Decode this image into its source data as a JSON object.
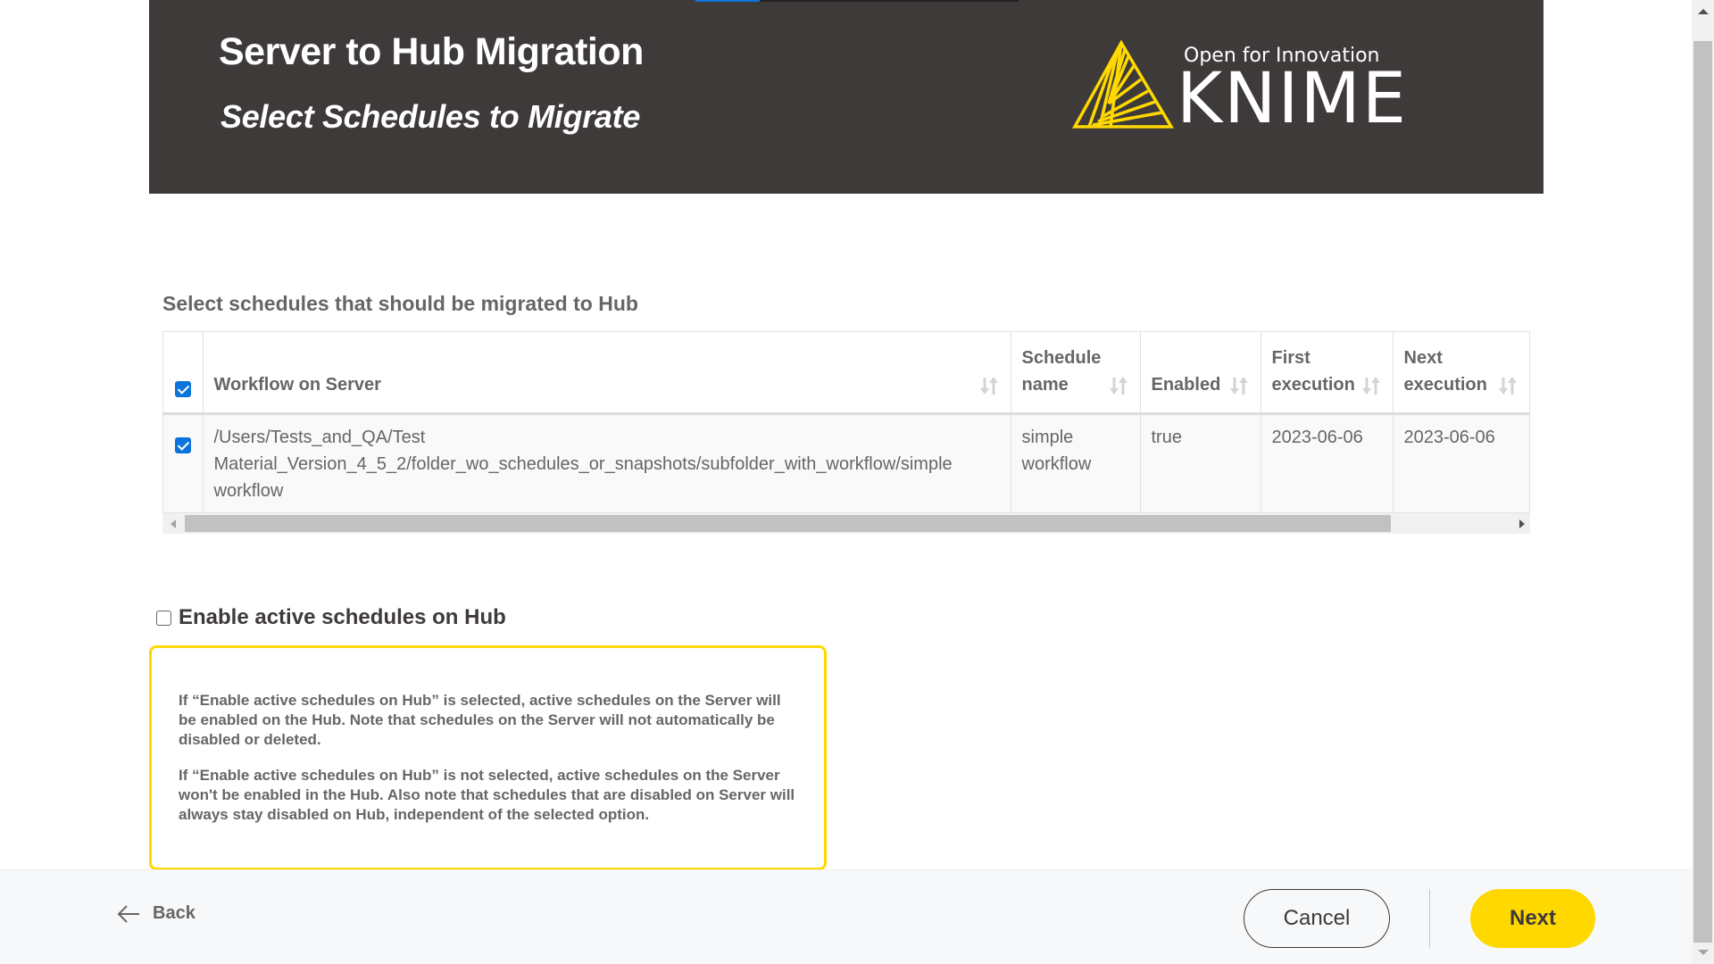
{
  "header": {
    "title": "Server to Hub Migration",
    "subtitle": "Select Schedules to Migrate",
    "progress_fraction": 0.2,
    "logo": {
      "tagline": "Open for Innovation",
      "name": "KNIME"
    }
  },
  "section_label": "Select schedules that should be migrated to Hub",
  "table": {
    "select_all_checked": true,
    "columns": [
      {
        "label": "Workflow on Server",
        "sortable": true
      },
      {
        "label": "Schedule name",
        "sortable": true
      },
      {
        "label": "Enabled",
        "sortable": true
      },
      {
        "label": "First execution",
        "sortable": true
      },
      {
        "label": "Next execution",
        "sortable": true
      }
    ],
    "rows": [
      {
        "checked": true,
        "workflow": "/Users/Tests_and_QA/Test Material_Version_4_5_2/folder_wo_schedules_or_snapshots/subfolder_with_workflow/simple workflow",
        "schedule_name": "simple workflow",
        "enabled": "true",
        "first_execution": "2023-06-06",
        "next_execution": "2023-06-06"
      }
    ]
  },
  "enable_option": {
    "label": "Enable active schedules on Hub",
    "checked": false
  },
  "info": {
    "paragraphs": [
      "If “Enable active schedules on Hub” is selected, active schedules on the Server will be enabled on the Hub. Note that schedules on the Server will not automatically be disabled or deleted.",
      "If “Enable active schedules on Hub” is not selected, active schedules on the Server won't be enabled in the Hub. Also note that schedules that are disabled on Server will always stay disabled on Hub, independent of the selected option."
    ]
  },
  "footer": {
    "back_label": "Back",
    "cancel_label": "Cancel",
    "next_label": "Next"
  },
  "colors": {
    "header_bg": "#3e3a39",
    "accent_yellow": "#ffd800",
    "checkbox_blue": "#0a74da",
    "progress_blue": "#0a74da"
  }
}
